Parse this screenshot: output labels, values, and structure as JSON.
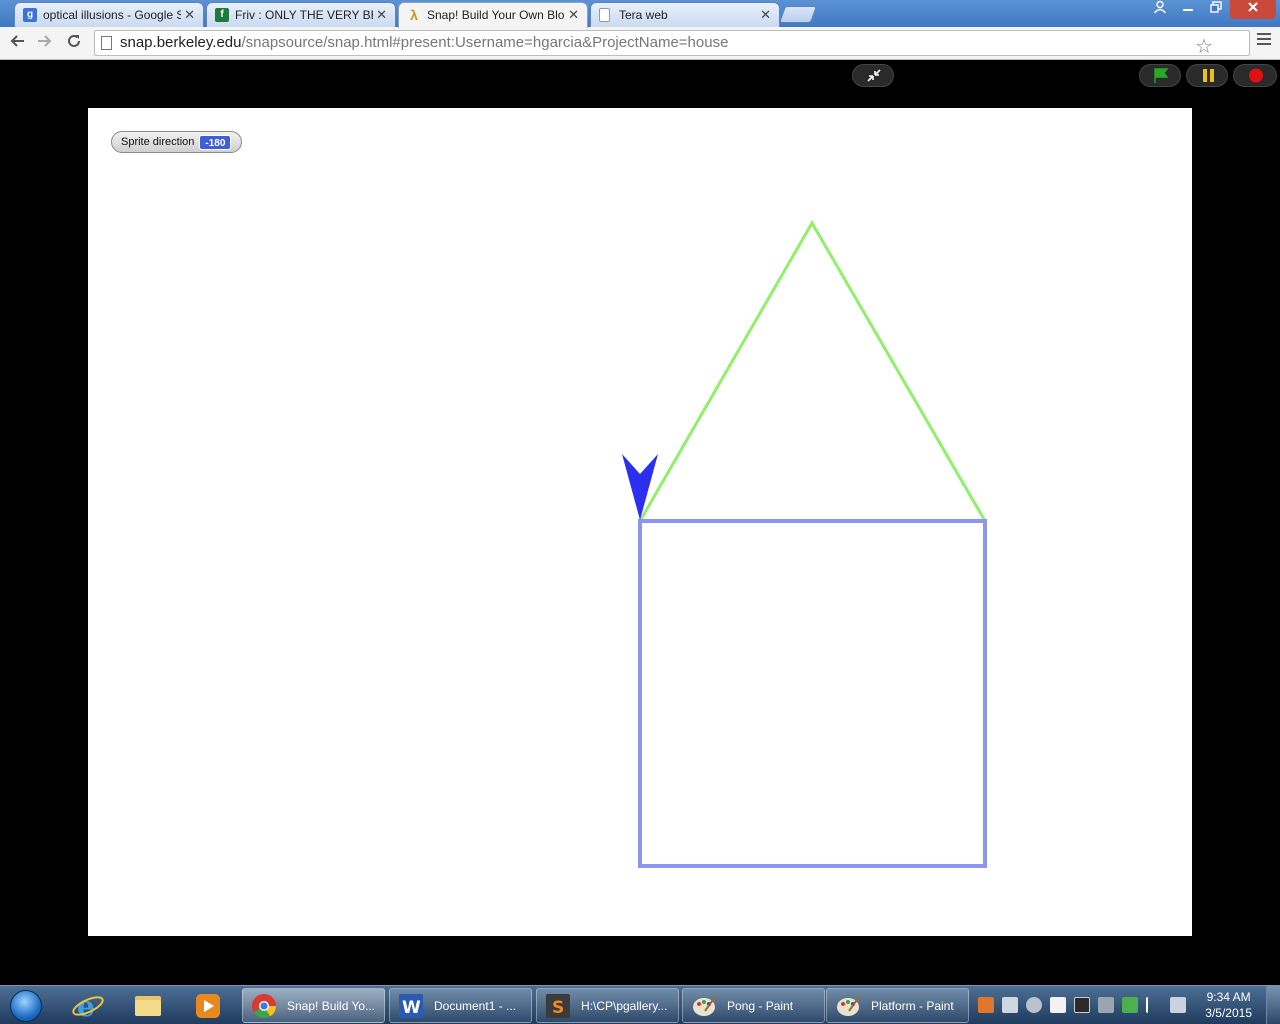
{
  "browser": {
    "tabs": [
      {
        "title": "optical illusions - Google S",
        "favicon": "google-icon",
        "active": false
      },
      {
        "title": "Friv : ONLY THE VERY BES",
        "favicon": "friv-icon",
        "active": false
      },
      {
        "title": "Snap! Build Your Own Blo",
        "favicon": "snap-lambda-icon",
        "active": true
      },
      {
        "title": "Tera web",
        "favicon": "page-icon",
        "active": false
      }
    ],
    "close_glyph": "✕",
    "url_host": "snap.berkeley.edu",
    "url_path": "/snapsource/snap.html#present:Username=hgarcia&ProjectName=house"
  },
  "snap": {
    "watcher_label": "Sprite direction",
    "watcher_value": "-180",
    "colors": {
      "roof": "#8ff06a",
      "walls": "#8c96ef",
      "sprite": "#2b2ff0",
      "flag": "#2aa62a",
      "pause": "#e8c21a",
      "stop": "#e01010"
    }
  },
  "taskbar": {
    "buttons": [
      {
        "label": "Snap! Build Yo...",
        "icon": "chrome-icon",
        "active": true
      },
      {
        "label": "Document1 - ...",
        "icon": "word-icon",
        "active": false
      },
      {
        "label": "H:\\CP\\pgallery...",
        "icon": "sublime-icon",
        "active": false
      },
      {
        "label": "Pong - Paint",
        "icon": "paint-icon",
        "active": false
      },
      {
        "label": "Platform - Paint",
        "icon": "paint-icon",
        "active": false
      }
    ],
    "time": "9:34 AM",
    "date": "3/5/2015"
  }
}
